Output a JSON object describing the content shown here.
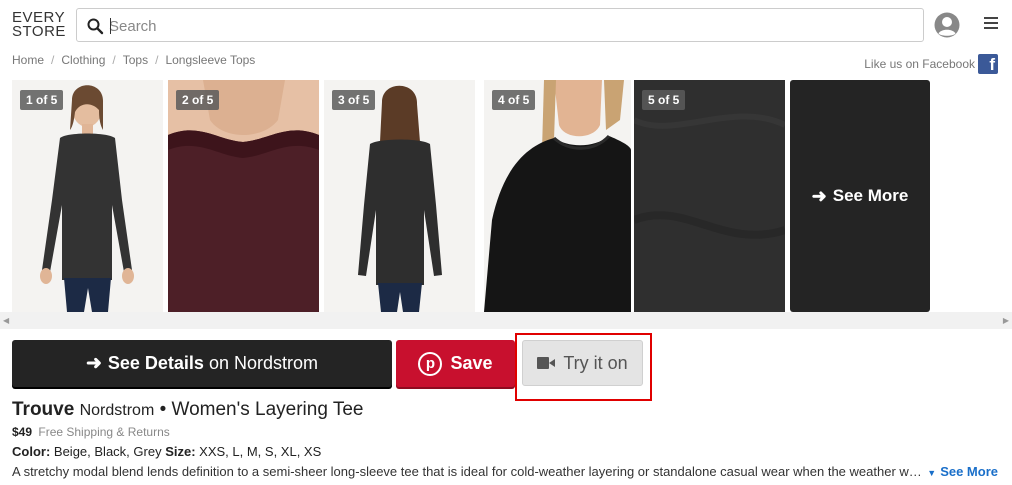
{
  "header": {
    "logo_line1": "EVERY",
    "logo_line2": "STORE",
    "search_placeholder": "Search",
    "icons": [
      "search-icon",
      "user-icon",
      "menu-icon"
    ]
  },
  "breadcrumb": [
    "Home",
    "Clothing",
    "Tops",
    "Longsleeve Tops"
  ],
  "facebook": {
    "label": "Like us on Facebook",
    "icon": "facebook-icon"
  },
  "gallery": {
    "photos": [
      {
        "badge": "1 of 5"
      },
      {
        "badge": "2 of 5"
      },
      {
        "badge": "3 of 5"
      },
      {
        "badge": "4 of 5"
      },
      {
        "badge": "5 of 5"
      }
    ],
    "see_more": "See More"
  },
  "buttons": {
    "details_strong": "See Details",
    "details_rest": "on Nordstrom",
    "save": "Save",
    "try_on": "Try it on"
  },
  "product": {
    "brand": "Trouve",
    "store": "Nordstrom",
    "bullet": "•",
    "name": "Women's Layering Tee",
    "price": "$49",
    "shipping": "Free Shipping & Returns",
    "color_label": "Color:",
    "color_value": "Beige, Black, Grey",
    "size_label": "Size:",
    "size_value": "XXS, L, M, S, XL, XS",
    "description": "A stretchy modal blend lends definition to a semi-sheer long-sleeve tee that is ideal for cold-weather layering or standalone casual wear when the weather warms up.",
    "see_more": "See More"
  },
  "colors": {
    "dark_button": "#242424",
    "save_red": "#c8102e",
    "highlight": "#e00000",
    "link_blue": "#1a6fc9"
  }
}
